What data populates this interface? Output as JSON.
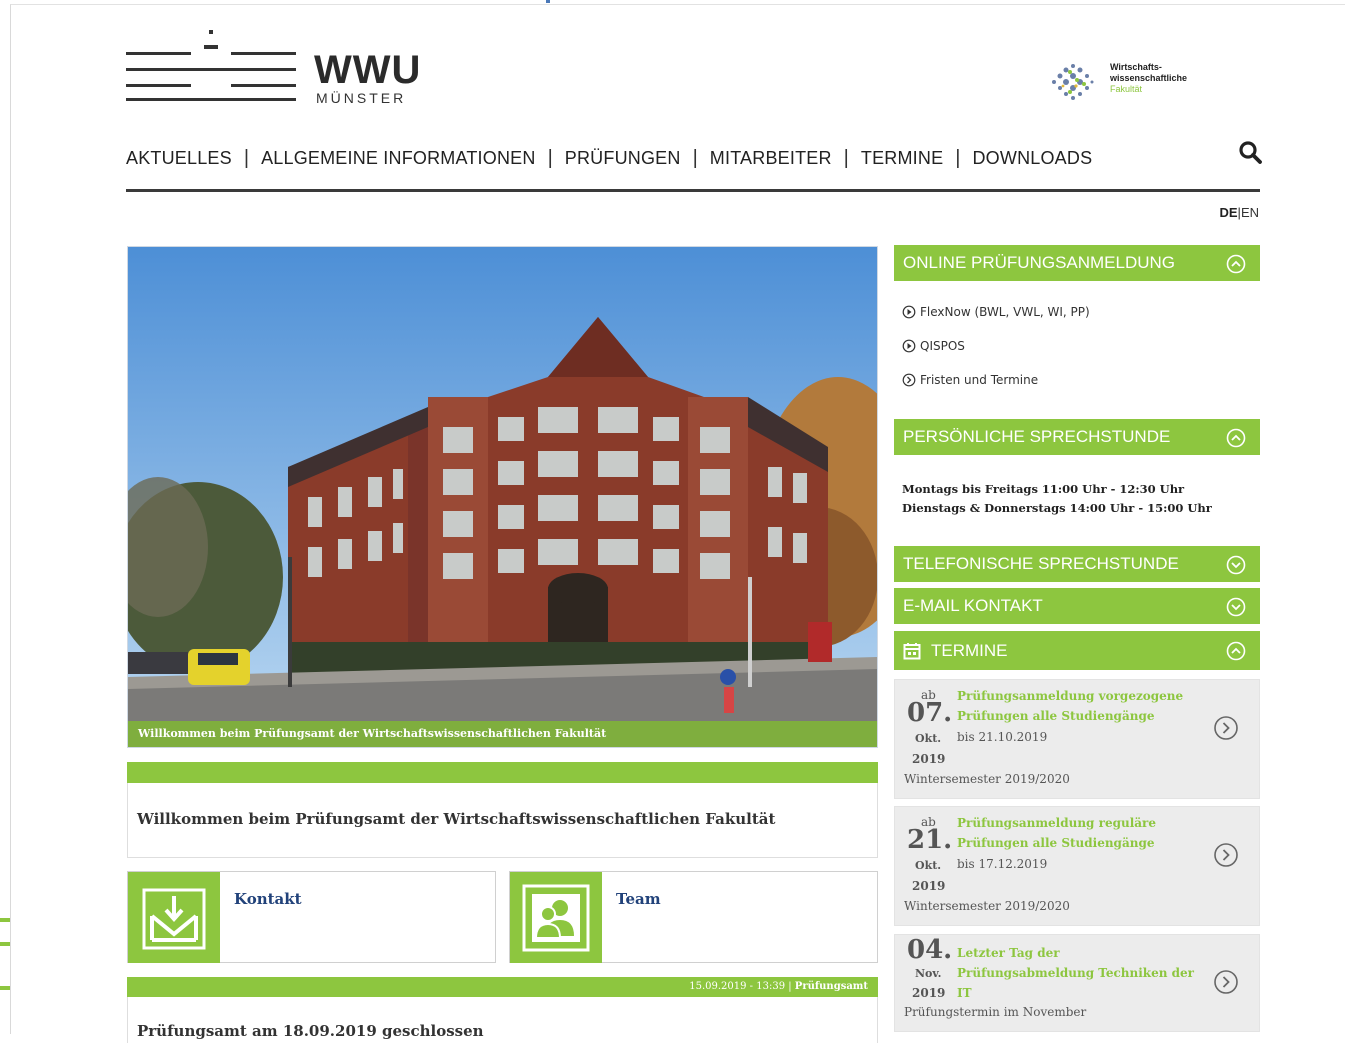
{
  "header": {
    "logo_text": "WWU",
    "logo_sub": "MÜNSTER",
    "faculty_line1": "Wirtschafts-",
    "faculty_line2": "wissenschaftliche",
    "faculty_line3": "Fakultät"
  },
  "nav": {
    "items": [
      "AKTUELLES",
      "ALLGEMEINE INFORMATIONEN",
      "PRÜFUNGEN",
      "MITARBEITER",
      "TERMINE",
      "DOWNLOADS"
    ],
    "separator": "|"
  },
  "lang": {
    "de": "DE",
    "sep": "|",
    "en": "EN"
  },
  "hero": {
    "caption": "Willkommen beim Prüfungsamt der Wirtschaftswissenschaftlichen Fakultät"
  },
  "welcome": {
    "title": "Willkommen beim Prüfungsamt der Wirtschaftswissenschaftlichen Fakultät"
  },
  "tiles": [
    {
      "label": "Kontakt",
      "icon": "mail-download-icon"
    },
    {
      "label": "Team",
      "icon": "team-icon"
    }
  ],
  "news": {
    "meta": "15.09.2019 - 13:39 |",
    "source": "Prüfungsamt",
    "title": "Prüfungsamt am 18.09.2019 geschlossen"
  },
  "sidebar": {
    "online": {
      "title": "ONLINE PRÜFUNGSANMELDUNG",
      "links": [
        "FlexNow (BWL, VWL, WI, PP)",
        "QISPOS",
        "Fristen und Termine"
      ]
    },
    "personal": {
      "title": "PERSÖNLICHE SPRECHSTUNDE",
      "line1": "Montags bis Freitags 11:00 Uhr - 12:30 Uhr",
      "line2": "Dienstags & Donnerstags 14:00 Uhr - 15:00 Uhr"
    },
    "phone": {
      "title": "TELEFONISCHE SPRECHSTUNDE"
    },
    "email": {
      "title": "E-MAIL KONTAKT"
    },
    "termine": {
      "title": "TERMINE",
      "events": [
        {
          "ab": "ab",
          "day": "07.",
          "month": "Okt.",
          "year": "2019",
          "title": "Prüfungsanmeldung vorgezogene Prüfungen alle Studiengänge",
          "until": "bis 21.10.2019",
          "semester": "Wintersemester 2019/2020"
        },
        {
          "ab": "ab",
          "day": "21.",
          "month": "Okt.",
          "year": "2019",
          "title": "Prüfungsanmeldung reguläre Prüfungen alle Studiengänge",
          "until": "bis 17.12.2019",
          "semester": "Wintersemester 2019/2020"
        },
        {
          "ab": "",
          "day": "04.",
          "month": "Nov.",
          "year": "2019",
          "title": "Letzter Tag der Prüfungsabmeldung Techniken der IT",
          "until": "",
          "semester": "Prüfungstermin im November"
        }
      ]
    }
  },
  "colors": {
    "accent": "#8dc63f",
    "link_blue": "#21427a",
    "text": "#222222"
  }
}
